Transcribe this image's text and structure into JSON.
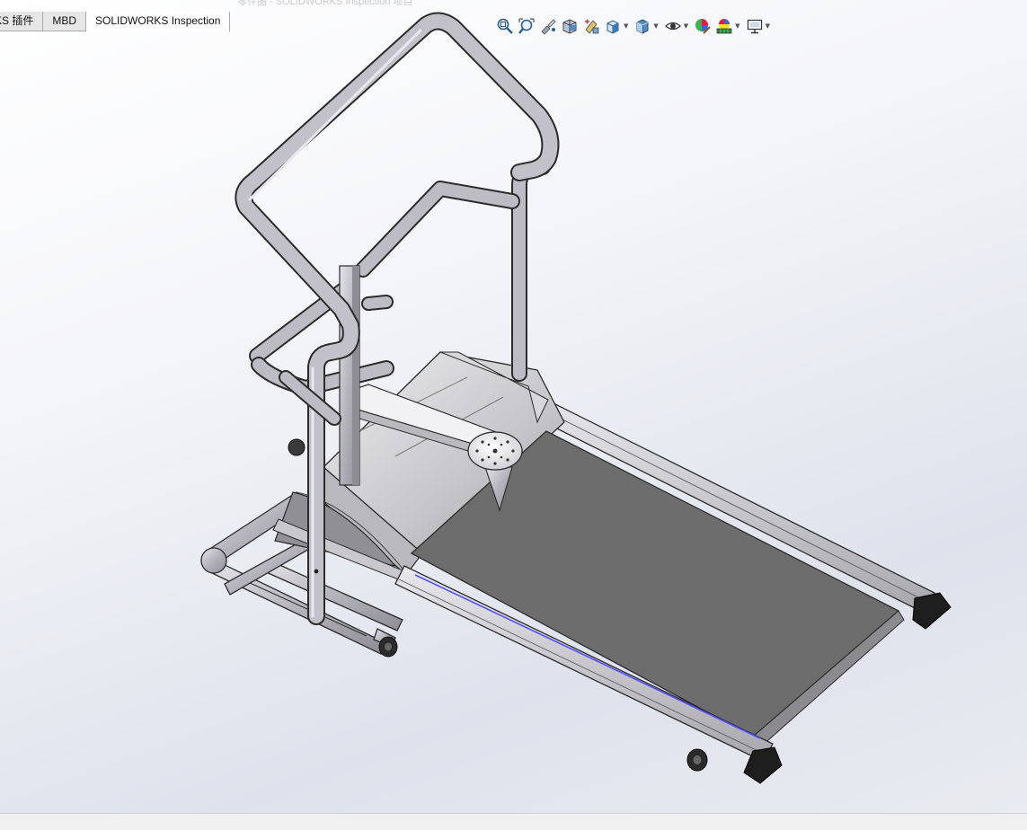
{
  "window": {
    "ghost_title": "零件图 - SOLIDWORKS Inspection 项目"
  },
  "tabs": [
    {
      "label": "KS 插件",
      "active": false
    },
    {
      "label": "MBD",
      "active": false
    },
    {
      "label": "SOLIDWORKS Inspection",
      "active": true
    }
  ],
  "toolbar": {
    "items": [
      {
        "icon": "zoom-to-fit-icon",
        "dropdown": false
      },
      {
        "icon": "zoom-to-area-icon",
        "dropdown": false
      },
      {
        "icon": "previous-view-icon",
        "dropdown": false
      },
      {
        "icon": "section-view-icon",
        "dropdown": false
      },
      {
        "icon": "dynamic-annotation-icon",
        "dropdown": false
      },
      {
        "icon": "view-orientation-icon",
        "dropdown": true
      },
      {
        "icon": "display-style-icon",
        "dropdown": true
      },
      {
        "icon": "hide-show-items-icon",
        "dropdown": true
      },
      {
        "icon": "edit-appearance-icon",
        "dropdown": false
      },
      {
        "icon": "apply-scene-icon",
        "dropdown": true
      },
      {
        "icon": "view-settings-icon",
        "dropdown": true
      }
    ]
  },
  "model": {
    "name": "treadmill-assembly",
    "colors": {
      "tube": "#bdbcc4",
      "tube_edge": "#2b2b2b",
      "belt": "#6d6d6d",
      "housing": "#cfcfd3",
      "end_cap": "#1e1e1e",
      "edge_highlight": "#5050ff"
    }
  }
}
